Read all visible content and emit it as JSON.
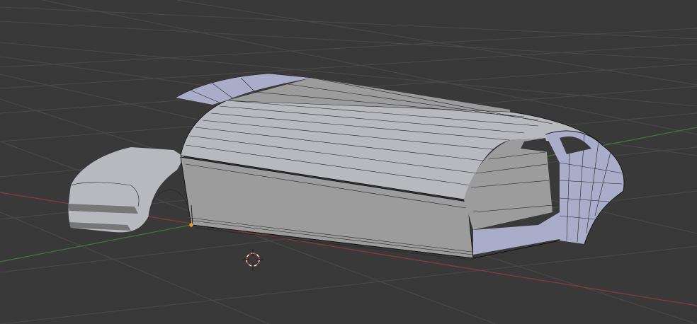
{
  "app": {
    "name": "",
    "view": "3D Viewport"
  },
  "colors": {
    "background": "#393939",
    "grid": "#4a4a4a",
    "x_axis": "#8a3a3a",
    "y_axis": "#3d7a3a",
    "mesh": "#9c9c9c",
    "cursor_red": "#d23030",
    "selected_vertex": "#f0a030"
  },
  "icons": {
    "cursor": "3d-cursor-icon",
    "origin": "object-origin-icon"
  }
}
